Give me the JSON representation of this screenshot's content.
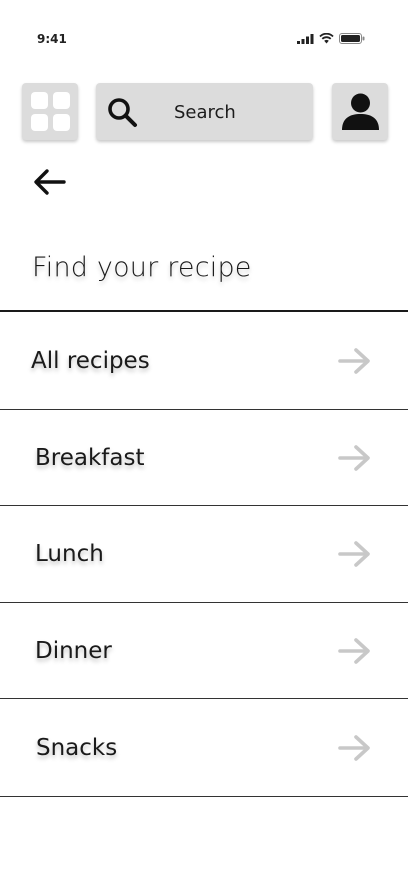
{
  "status_bar": {
    "time": "9:41",
    "icons": [
      "cellular-signal-icon",
      "wifi-icon",
      "battery-icon"
    ]
  },
  "top_bar": {
    "menu_icon": "grid-icon",
    "search": {
      "icon": "search-icon",
      "label": "Search"
    },
    "profile_icon": "user-icon"
  },
  "nav": {
    "back_icon": "arrow-left-icon"
  },
  "page": {
    "title": "Find your recipe"
  },
  "categories": [
    {
      "label": "All recipes",
      "icon": "arrow-right-icon"
    },
    {
      "label": "Breakfast",
      "icon": "arrow-right-icon"
    },
    {
      "label": "Lunch",
      "icon": "arrow-right-icon"
    },
    {
      "label": "Dinner",
      "icon": "arrow-right-icon"
    },
    {
      "label": "Snacks",
      "icon": "arrow-right-icon"
    }
  ],
  "colors": {
    "tile_background": "#dcdcdc",
    "text": "#1a1a1a",
    "row_arrow": "#c8c8c8",
    "divider": "#333333"
  }
}
